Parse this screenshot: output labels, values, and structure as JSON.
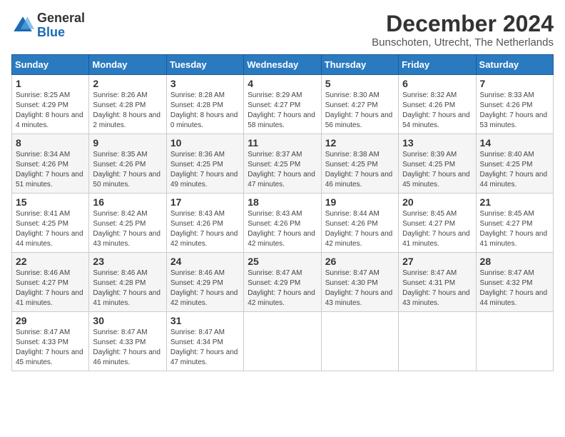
{
  "header": {
    "logo_general": "General",
    "logo_blue": "Blue",
    "month_title": "December 2024",
    "location": "Bunschoten, Utrecht, The Netherlands"
  },
  "calendar": {
    "weekdays": [
      "Sunday",
      "Monday",
      "Tuesday",
      "Wednesday",
      "Thursday",
      "Friday",
      "Saturday"
    ],
    "weeks": [
      [
        {
          "day": "1",
          "sunrise": "8:25 AM",
          "sunset": "4:29 PM",
          "daylight": "8 hours and 4 minutes"
        },
        {
          "day": "2",
          "sunrise": "8:26 AM",
          "sunset": "4:28 PM",
          "daylight": "8 hours and 2 minutes"
        },
        {
          "day": "3",
          "sunrise": "8:28 AM",
          "sunset": "4:28 PM",
          "daylight": "8 hours and 0 minutes"
        },
        {
          "day": "4",
          "sunrise": "8:29 AM",
          "sunset": "4:27 PM",
          "daylight": "7 hours and 58 minutes"
        },
        {
          "day": "5",
          "sunrise": "8:30 AM",
          "sunset": "4:27 PM",
          "daylight": "7 hours and 56 minutes"
        },
        {
          "day": "6",
          "sunrise": "8:32 AM",
          "sunset": "4:26 PM",
          "daylight": "7 hours and 54 minutes"
        },
        {
          "day": "7",
          "sunrise": "8:33 AM",
          "sunset": "4:26 PM",
          "daylight": "7 hours and 53 minutes"
        }
      ],
      [
        {
          "day": "8",
          "sunrise": "8:34 AM",
          "sunset": "4:26 PM",
          "daylight": "7 hours and 51 minutes"
        },
        {
          "day": "9",
          "sunrise": "8:35 AM",
          "sunset": "4:26 PM",
          "daylight": "7 hours and 50 minutes"
        },
        {
          "day": "10",
          "sunrise": "8:36 AM",
          "sunset": "4:25 PM",
          "daylight": "7 hours and 49 minutes"
        },
        {
          "day": "11",
          "sunrise": "8:37 AM",
          "sunset": "4:25 PM",
          "daylight": "7 hours and 47 minutes"
        },
        {
          "day": "12",
          "sunrise": "8:38 AM",
          "sunset": "4:25 PM",
          "daylight": "7 hours and 46 minutes"
        },
        {
          "day": "13",
          "sunrise": "8:39 AM",
          "sunset": "4:25 PM",
          "daylight": "7 hours and 45 minutes"
        },
        {
          "day": "14",
          "sunrise": "8:40 AM",
          "sunset": "4:25 PM",
          "daylight": "7 hours and 44 minutes"
        }
      ],
      [
        {
          "day": "15",
          "sunrise": "8:41 AM",
          "sunset": "4:25 PM",
          "daylight": "7 hours and 44 minutes"
        },
        {
          "day": "16",
          "sunrise": "8:42 AM",
          "sunset": "4:25 PM",
          "daylight": "7 hours and 43 minutes"
        },
        {
          "day": "17",
          "sunrise": "8:43 AM",
          "sunset": "4:26 PM",
          "daylight": "7 hours and 42 minutes"
        },
        {
          "day": "18",
          "sunrise": "8:43 AM",
          "sunset": "4:26 PM",
          "daylight": "7 hours and 42 minutes"
        },
        {
          "day": "19",
          "sunrise": "8:44 AM",
          "sunset": "4:26 PM",
          "daylight": "7 hours and 42 minutes"
        },
        {
          "day": "20",
          "sunrise": "8:45 AM",
          "sunset": "4:27 PM",
          "daylight": "7 hours and 41 minutes"
        },
        {
          "day": "21",
          "sunrise": "8:45 AM",
          "sunset": "4:27 PM",
          "daylight": "7 hours and 41 minutes"
        }
      ],
      [
        {
          "day": "22",
          "sunrise": "8:46 AM",
          "sunset": "4:27 PM",
          "daylight": "7 hours and 41 minutes"
        },
        {
          "day": "23",
          "sunrise": "8:46 AM",
          "sunset": "4:28 PM",
          "daylight": "7 hours and 41 minutes"
        },
        {
          "day": "24",
          "sunrise": "8:46 AM",
          "sunset": "4:29 PM",
          "daylight": "7 hours and 42 minutes"
        },
        {
          "day": "25",
          "sunrise": "8:47 AM",
          "sunset": "4:29 PM",
          "daylight": "7 hours and 42 minutes"
        },
        {
          "day": "26",
          "sunrise": "8:47 AM",
          "sunset": "4:30 PM",
          "daylight": "7 hours and 43 minutes"
        },
        {
          "day": "27",
          "sunrise": "8:47 AM",
          "sunset": "4:31 PM",
          "daylight": "7 hours and 43 minutes"
        },
        {
          "day": "28",
          "sunrise": "8:47 AM",
          "sunset": "4:32 PM",
          "daylight": "7 hours and 44 minutes"
        }
      ],
      [
        {
          "day": "29",
          "sunrise": "8:47 AM",
          "sunset": "4:33 PM",
          "daylight": "7 hours and 45 minutes"
        },
        {
          "day": "30",
          "sunrise": "8:47 AM",
          "sunset": "4:33 PM",
          "daylight": "7 hours and 46 minutes"
        },
        {
          "day": "31",
          "sunrise": "8:47 AM",
          "sunset": "4:34 PM",
          "daylight": "7 hours and 47 minutes"
        },
        null,
        null,
        null,
        null
      ]
    ]
  }
}
